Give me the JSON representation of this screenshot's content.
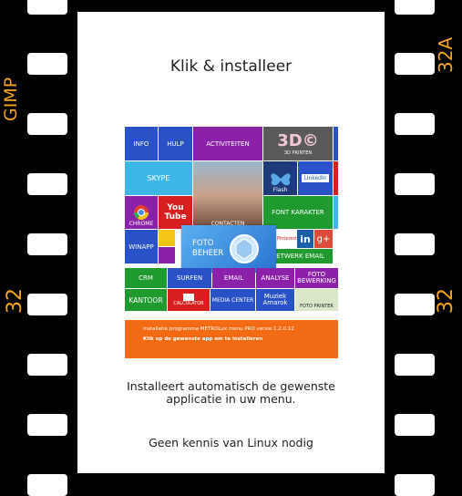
{
  "film": {
    "left_top_label": "GIMP",
    "left_mid_label": "32",
    "right_top_label": "32A",
    "right_mid_label": "32"
  },
  "page": {
    "title": "Klik & installeer",
    "description_line1": "Installeert automatisch de gewenste",
    "description_line2": "applicatie in uw menu.",
    "note": "Geen kennis van Linux nodig"
  },
  "screenshot": {
    "tiles": {
      "info": "INFO",
      "hulp": "HULP",
      "activiteiten": "ACTIVITEITEN",
      "printen_big": "3D©",
      "printen_small": "3D PRINTEN",
      "skype": "SKYPE",
      "flash": "Flash",
      "linkedin": "LinkedIn",
      "chrome": "CHROME",
      "youtube": "You Tube",
      "contacten": "CONTACTEN",
      "font": "FONT KARAKTER",
      "winapp": "WINAPP",
      "foto_beheer_1": "FOTO",
      "foto_beheer_2": "BEHEER",
      "pinterest": "Pinterest",
      "in": "in",
      "gplus": "g+",
      "netwerk": "NETWERK EMAIL",
      "crm": "CRM",
      "surfen": "SURFEN",
      "email": "EMAIL",
      "analyse": "ANALYSE",
      "foto_bewerking_1": "FOTO",
      "foto_bewerking_2": "BEWERKING",
      "kantoor": "KANTOOR",
      "calculator": "CALCULATOR",
      "media": "MEDIA CENTER",
      "muziek_1": "Muziek",
      "muziek_2": "Amarok",
      "foto_printer": "FOTO PRINTER"
    },
    "info_line1": "Installatie programma  METROLux menu PRO versie 1.2.0.12",
    "info_line2": "Klik op de gewenste app om te installeren"
  },
  "colors": {
    "film_text": "#f3a51c",
    "info_bar": "#f26a14",
    "tile_blue": "#2a52c8",
    "tile_purple": "#8b21a8",
    "tile_green": "#1f9a2e",
    "tile_red": "#d81f1f"
  }
}
